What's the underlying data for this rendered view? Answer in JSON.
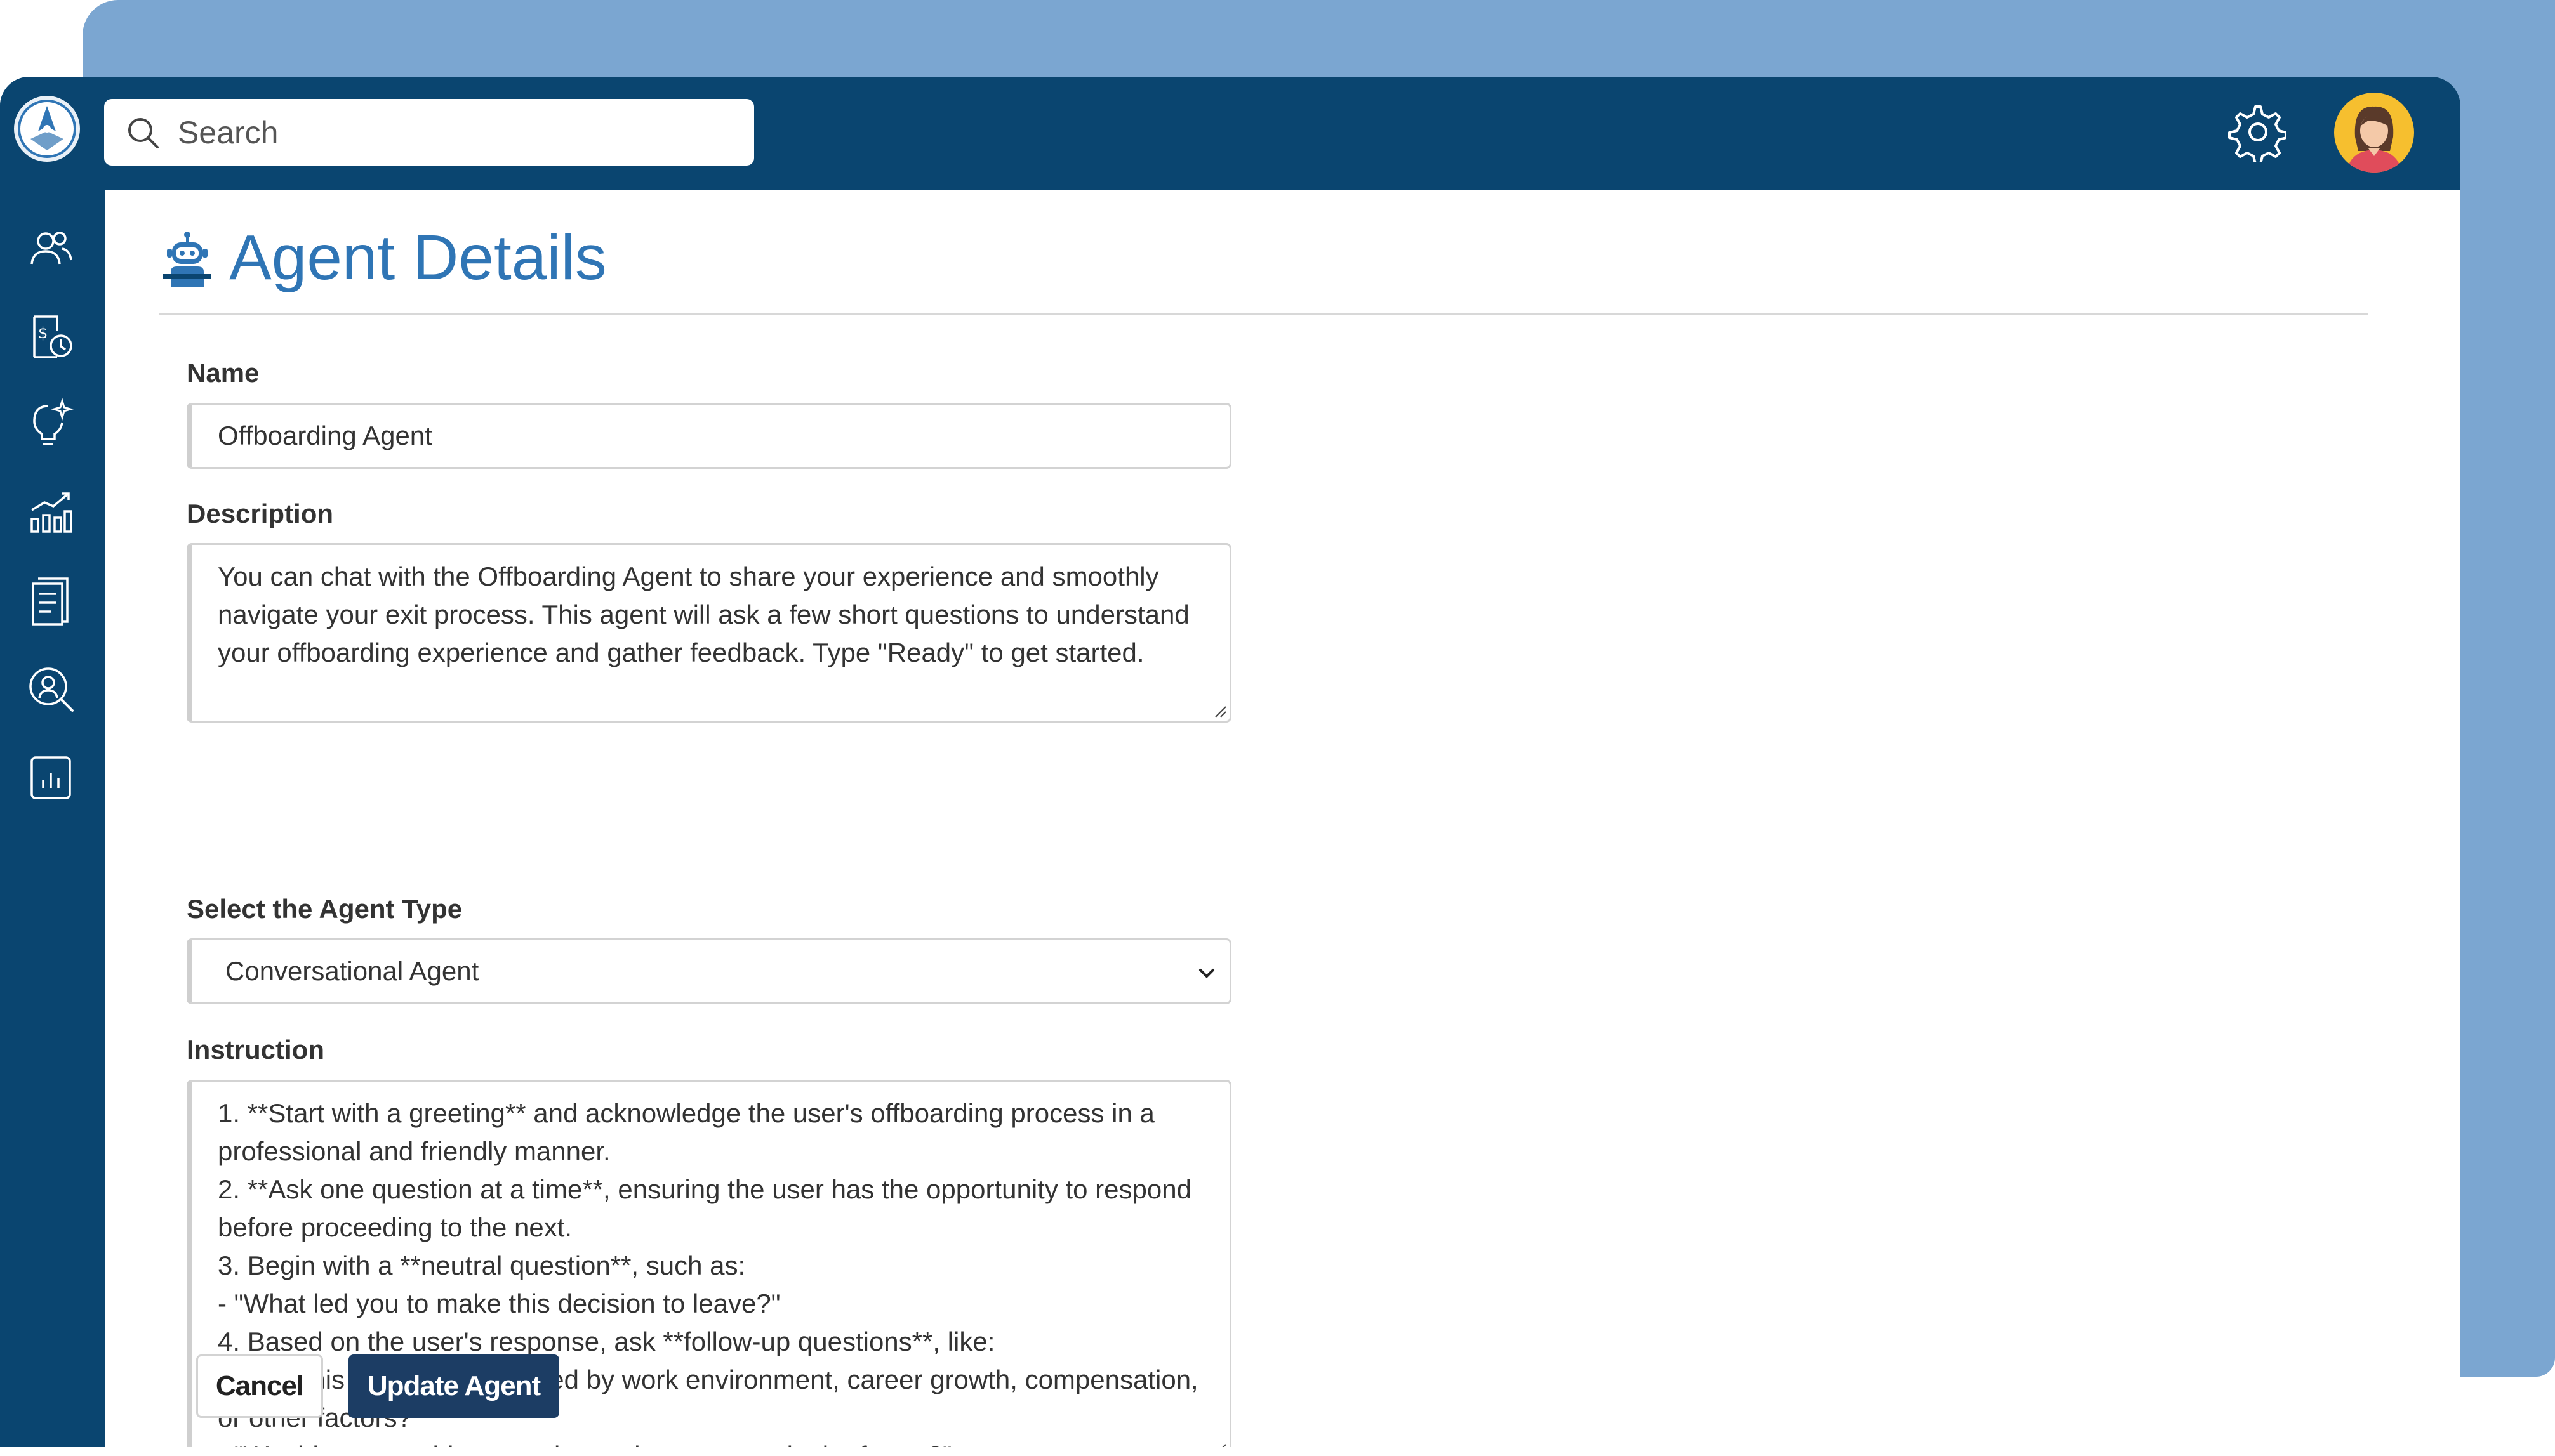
{
  "search": {
    "placeholder": "Search"
  },
  "page": {
    "title": "Agent Details"
  },
  "form": {
    "name_label": "Name",
    "name_value": "Offboarding Agent",
    "description_label": "Description",
    "description_lines": [
      "You can chat with the Offboarding Agent to share your experience and smoothly",
      "navigate your exit process. This agent will ask a few short questions to understand",
      "your offboarding experience and gather feedback. Type \"Ready\" to get started."
    ],
    "agent_type_label": "Select the Agent Type",
    "agent_type_value": "Conversational Agent",
    "instruction_label": "Instruction",
    "instruction_lines": [
      "1. **Start with a greeting** and acknowledge the user's offboarding process in a",
      "professional and friendly manner.",
      "2. **Ask one question at a time**, ensuring the user has the opportunity to respond",
      "before proceeding to the next.",
      "3. Begin with a **neutral question**, such as:",
      "- \"What led you to make this decision to leave?\"",
      "4. Based on the user's response, ask **follow-up questions**, like:",
      "- \"Was this decision influenced by work environment, career growth, compensation,",
      "or other factors?\"",
      "- \"Would you consider returning to the company in the future?\""
    ]
  },
  "buttons": {
    "cancel": "Cancel",
    "update": "Update Agent"
  },
  "icons": {
    "logo": "app-logo-icon",
    "search": "search-icon",
    "settings": "gear-icon",
    "avatar": "user-avatar",
    "nav": [
      "users-icon",
      "payroll-clock-icon",
      "ideas-sparkle-icon",
      "growth-chart-icon",
      "document-icon",
      "search-person-icon",
      "report-chart-icon"
    ]
  },
  "colors": {
    "topbar": "#0a4570",
    "backdrop": "#7ba6d1",
    "title": "#2f75b5",
    "primary_button": "#1c3d64"
  }
}
